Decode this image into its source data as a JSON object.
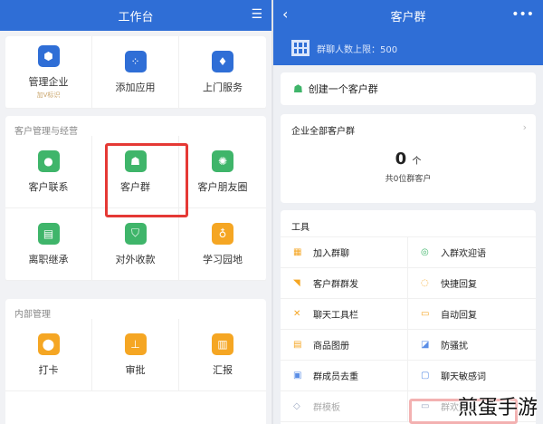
{
  "left": {
    "title": "工作台",
    "settings_icon": "list-settings-icon",
    "top_items": [
      {
        "label": "管理企业",
        "sub": "加V标识",
        "icon": "hexagon-icon",
        "color": "#2f6ed6"
      },
      {
        "label": "添加应用",
        "icon": "apps-add-icon",
        "color": "#2f6ed6"
      },
      {
        "label": "上门服务",
        "icon": "tie-icon",
        "color": "#2f6ed6"
      }
    ],
    "section_customer": "客户管理与经营",
    "customer_items": [
      {
        "label": "客户联系",
        "icon": "chat-icon",
        "color": "#3fb56a"
      },
      {
        "label": "客户群",
        "icon": "group-icon",
        "color": "#3fb56a"
      },
      {
        "label": "客户朋友圈",
        "icon": "moments-icon",
        "color": "#3fb56a"
      },
      {
        "label": "离职继承",
        "icon": "document-icon",
        "color": "#3fb56a"
      },
      {
        "label": "对外收款",
        "icon": "payment-icon",
        "color": "#3fb56a"
      },
      {
        "label": "学习园地",
        "icon": "planet-icon",
        "color": "#f5a623"
      }
    ],
    "section_internal": "内部管理",
    "internal_items": [
      {
        "label": "打卡",
        "icon": "location-icon",
        "color": "#f5a623"
      },
      {
        "label": "审批",
        "icon": "stamp-icon",
        "color": "#f5a623"
      },
      {
        "label": "汇报",
        "icon": "report-icon",
        "color": "#f5a623"
      }
    ]
  },
  "right": {
    "title": "客户群",
    "back": "‹",
    "more": "•••",
    "limit_text": "群聊人数上限：500",
    "create_label": "创建一个客户群",
    "all_title": "企业全部客户群",
    "count": "0",
    "count_unit": "个",
    "count_caption": "共0位群客户",
    "tools_title": "工具",
    "tools": [
      {
        "label": "加入群聊",
        "icon": "qr-icon"
      },
      {
        "label": "入群欢迎语",
        "icon": "welcome-icon"
      },
      {
        "label": "客户群群发",
        "icon": "broadcast-icon"
      },
      {
        "label": "快捷回复",
        "icon": "quick-reply-icon"
      },
      {
        "label": "聊天工具栏",
        "icon": "toolbar-icon"
      },
      {
        "label": "自动回复",
        "icon": "auto-reply-icon"
      },
      {
        "label": "商品图册",
        "icon": "catalog-icon"
      },
      {
        "label": "防骚扰",
        "icon": "shield-icon"
      },
      {
        "label": "群成员去重",
        "icon": "dedupe-icon"
      },
      {
        "label": "聊天敏感词",
        "icon": "sensitive-word-icon"
      },
      {
        "label": "群模板",
        "icon": "template-icon"
      },
      {
        "label": "群欢迎语",
        "icon": "welcome-msg-icon"
      }
    ]
  },
  "watermark": "煎蛋手游"
}
